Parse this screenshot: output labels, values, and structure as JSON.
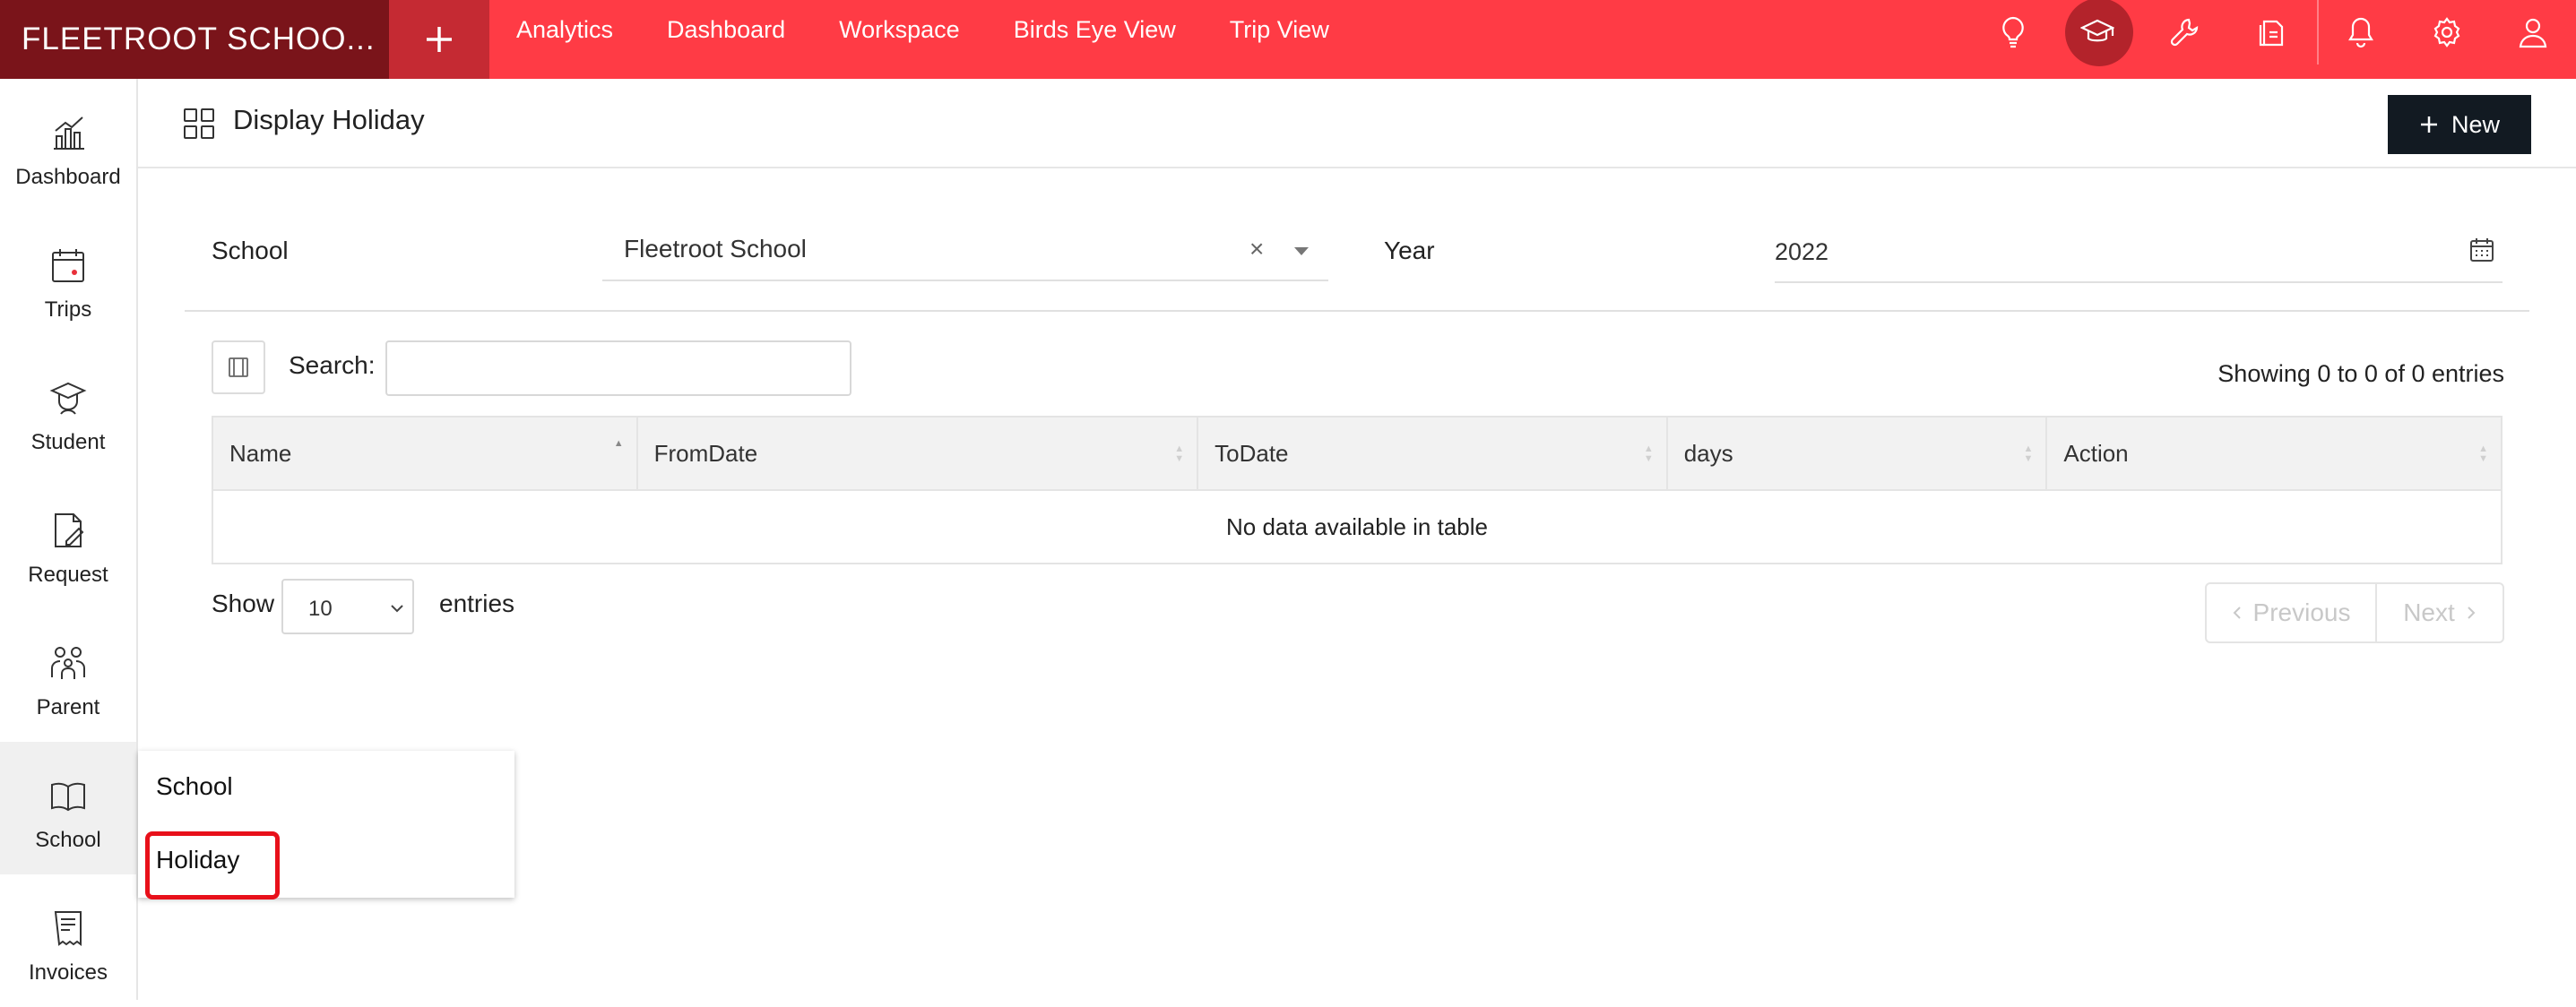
{
  "app": {
    "brand": "FLEETROOT SCHOO..."
  },
  "topnav": {
    "items": [
      {
        "label": "Analytics"
      },
      {
        "label": "Dashboard"
      },
      {
        "label": "Workspace"
      },
      {
        "label": "Birds Eye View"
      },
      {
        "label": "Trip View"
      }
    ],
    "icons": [
      "lightbulb-icon",
      "graduation-cap-icon",
      "wrench-icon",
      "documents-icon",
      "bell-icon",
      "gear-icon",
      "user-icon"
    ],
    "active_icon": "graduation-cap-icon"
  },
  "sidebar": {
    "items": [
      {
        "label": "Dashboard",
        "icon": "bar-chart-icon"
      },
      {
        "label": "Trips",
        "icon": "calendar-icon"
      },
      {
        "label": "Student",
        "icon": "student-icon"
      },
      {
        "label": "Request",
        "icon": "request-icon"
      },
      {
        "label": "Parent",
        "icon": "parent-icon"
      },
      {
        "label": "School",
        "icon": "book-icon",
        "active": true
      },
      {
        "label": "Invoices",
        "icon": "invoice-icon"
      }
    ]
  },
  "flyout": {
    "items": [
      {
        "label": "School"
      },
      {
        "label": "Holiday",
        "highlighted": true
      }
    ]
  },
  "page": {
    "title": "Display Holiday",
    "new_button": "New"
  },
  "filters": {
    "school_label": "School",
    "school_value": "Fleetroot School",
    "clear_symbol": "×",
    "year_label": "Year",
    "year_value": "2022"
  },
  "table": {
    "search_label": "Search:",
    "search_value": "",
    "info": "Showing 0 to 0 of 0 entries",
    "columns": [
      "Name",
      "FromDate",
      "ToDate",
      "days",
      "Action"
    ],
    "empty_message": "No data available in table",
    "show_label": "Show",
    "page_length": "10",
    "entries_label": "entries",
    "prev_label": "Previous",
    "next_label": "Next"
  },
  "colors": {
    "topbar": "#ff3b45",
    "brand_bg": "#7a141a",
    "new_button_bg": "#121a22",
    "highlight": "#e8101a"
  }
}
